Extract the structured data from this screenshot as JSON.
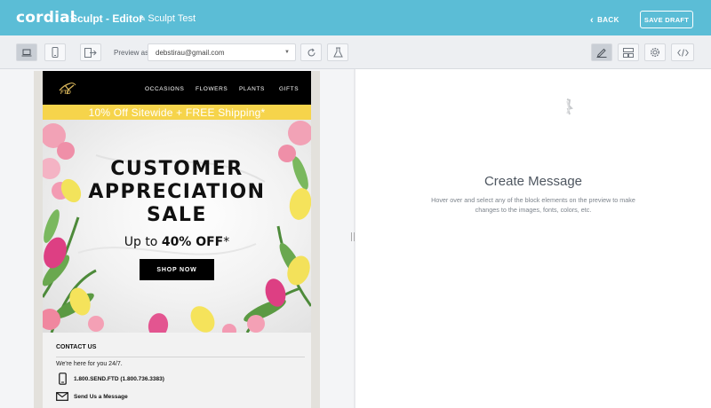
{
  "header": {
    "logo": "cordial",
    "app_title": "Sculpt - Editor",
    "project_name": "Sculpt Test",
    "back_label": "BACK",
    "save_label": "SAVE DRAFT"
  },
  "toolbar": {
    "preview_label": "Preview as",
    "preview_value": "debstirau@gmail.com",
    "icons": [
      "laptop-icon",
      "mobile-icon",
      "exit-icon",
      "refresh-icon",
      "flask-icon",
      "pencil-icon",
      "layout-icon",
      "gear-icon",
      "code-icon"
    ]
  },
  "email": {
    "brand": "FTD",
    "nav": [
      "OCCASIONS",
      "FLOWERS",
      "PLANTS",
      "GIFTS"
    ],
    "promo": "10% Off Sitewide + FREE Shipping*",
    "hero": {
      "line1": "CUSTOMER",
      "line2": "APPRECIATION",
      "line3": "SALE",
      "offer_prefix": "Up to ",
      "offer_bold": "40% OFF",
      "offer_suffix": "*",
      "button": "SHOP NOW"
    },
    "contact": {
      "title": "CONTACT US",
      "subtitle": "We're here for you 24/7.",
      "phone": "1.800.SEND.FTD (1.800.736.3383)",
      "message": "Send Us a Message"
    }
  },
  "panel": {
    "title": "Create Message",
    "description": "Hover over and select any of the block elements on the preview to make changes to the images, fonts, colors, etc."
  },
  "colors": {
    "header_bg": "#5bbdd6",
    "toolbar_bg": "#edeff2",
    "promo_bg": "#f6d44b",
    "email_nav_bg": "#000000"
  }
}
